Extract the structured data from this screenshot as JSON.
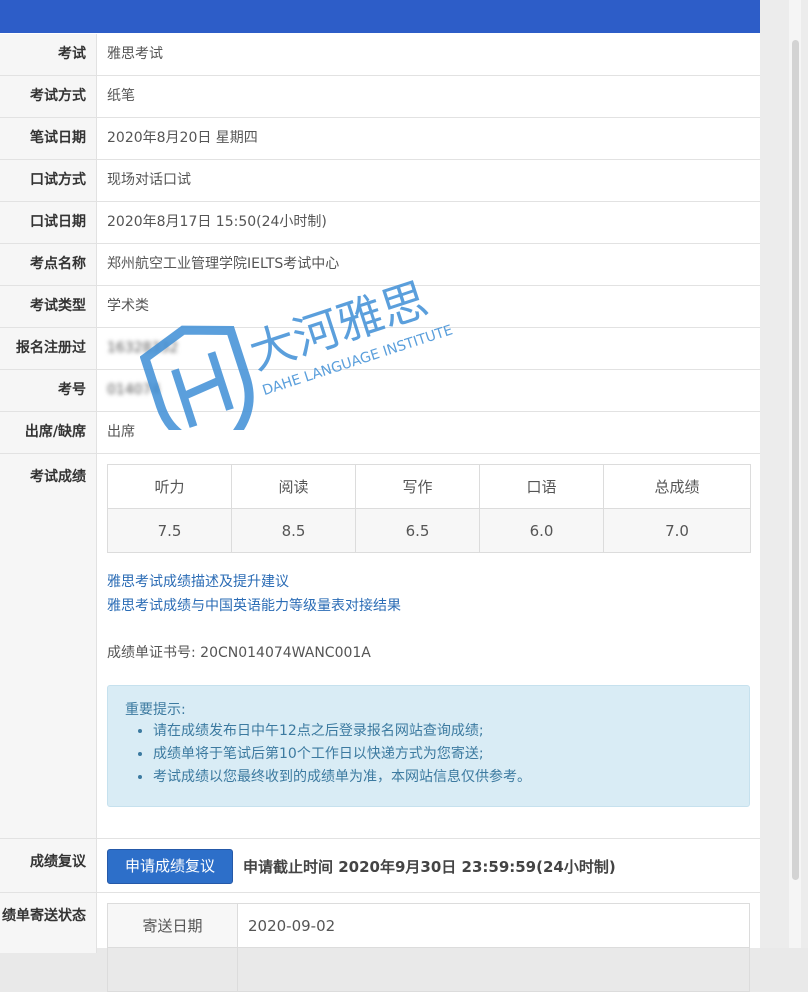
{
  "rows": [
    {
      "label": "考试",
      "value": "雅思考试"
    },
    {
      "label": "考试方式",
      "value": "纸笔"
    },
    {
      "label": "笔试日期",
      "value": "2020年8月20日 星期四"
    },
    {
      "label": "口试方式",
      "value": "现场对话口试"
    },
    {
      "label": "口试日期",
      "value": "2020年8月17日 15:50(24小时制)"
    },
    {
      "label": "考点名称",
      "value": "郑州航空工业管理学院IELTS考试中心"
    },
    {
      "label": "考试类型",
      "value": "学术类"
    },
    {
      "label": "报名注册过程)",
      "value": "16328332"
    },
    {
      "label": "考号",
      "value": "014074"
    },
    {
      "label": "出席/缺席",
      "value": "出席"
    }
  ],
  "scores": {
    "label": "考试成绩",
    "headers": [
      "听力",
      "阅读",
      "写作",
      "口语",
      "总成绩"
    ],
    "values": [
      "7.5",
      "8.5",
      "6.5",
      "6.0",
      "7.0"
    ],
    "links": [
      "雅思考试成绩描述及提升建议",
      "雅思考试成绩与中国英语能力等级量表对接结果"
    ],
    "certificate": "成绩单证书号: 20CN014074WANC001A"
  },
  "notice": {
    "title": "重要提示:",
    "items": [
      "请在成绩发布日中午12点之后登录报名网站查询成绩;",
      "成绩单将于笔试后第10个工作日以快递方式为您寄送;",
      "考试成绩以您最终收到的成绩单为准，本网站信息仅供参考。"
    ]
  },
  "review": {
    "label": "成绩复议",
    "button": "申请成绩复议",
    "deadline": "申请截止时间 2020年9月30日 23:59:59(24小时制)"
  },
  "shipping": {
    "label": "绩单寄送状态",
    "date_label": "寄送日期",
    "date_value": "2020-09-02"
  },
  "watermark": {
    "cn": "大河雅思",
    "en": "DAHE LANGUAGE INSTITUTE",
    "color": "#3f8fd6"
  }
}
